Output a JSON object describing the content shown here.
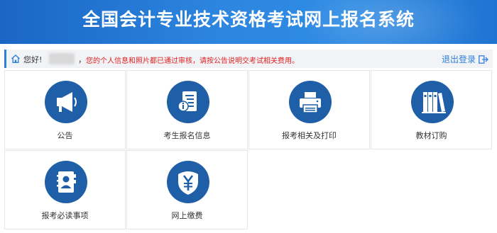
{
  "header": {
    "title": "全国会计专业技术资格考试网上报名系统"
  },
  "notice": {
    "greeting": "您好!",
    "comma": "，",
    "message": "您的个人信息和照片都已通过审核，请按公告说明交考试相关费用。",
    "logout_label": "退出登录"
  },
  "tiles": [
    {
      "label": "公告",
      "icon": "megaphone-icon"
    },
    {
      "label": "考生报名信息",
      "icon": "info-document-icon"
    },
    {
      "label": "报考相关及打印",
      "icon": "printer-icon"
    },
    {
      "label": "教材订购",
      "icon": "books-icon"
    },
    {
      "label": "报考必读事项",
      "icon": "contact-book-icon"
    },
    {
      "label": "网上缴费",
      "icon": "yen-shield-icon"
    }
  ],
  "colors": {
    "header": "#2d86e0",
    "icon_circle": "#1e5fa8",
    "notice_text": "#e02020",
    "link": "#2f80d8"
  }
}
